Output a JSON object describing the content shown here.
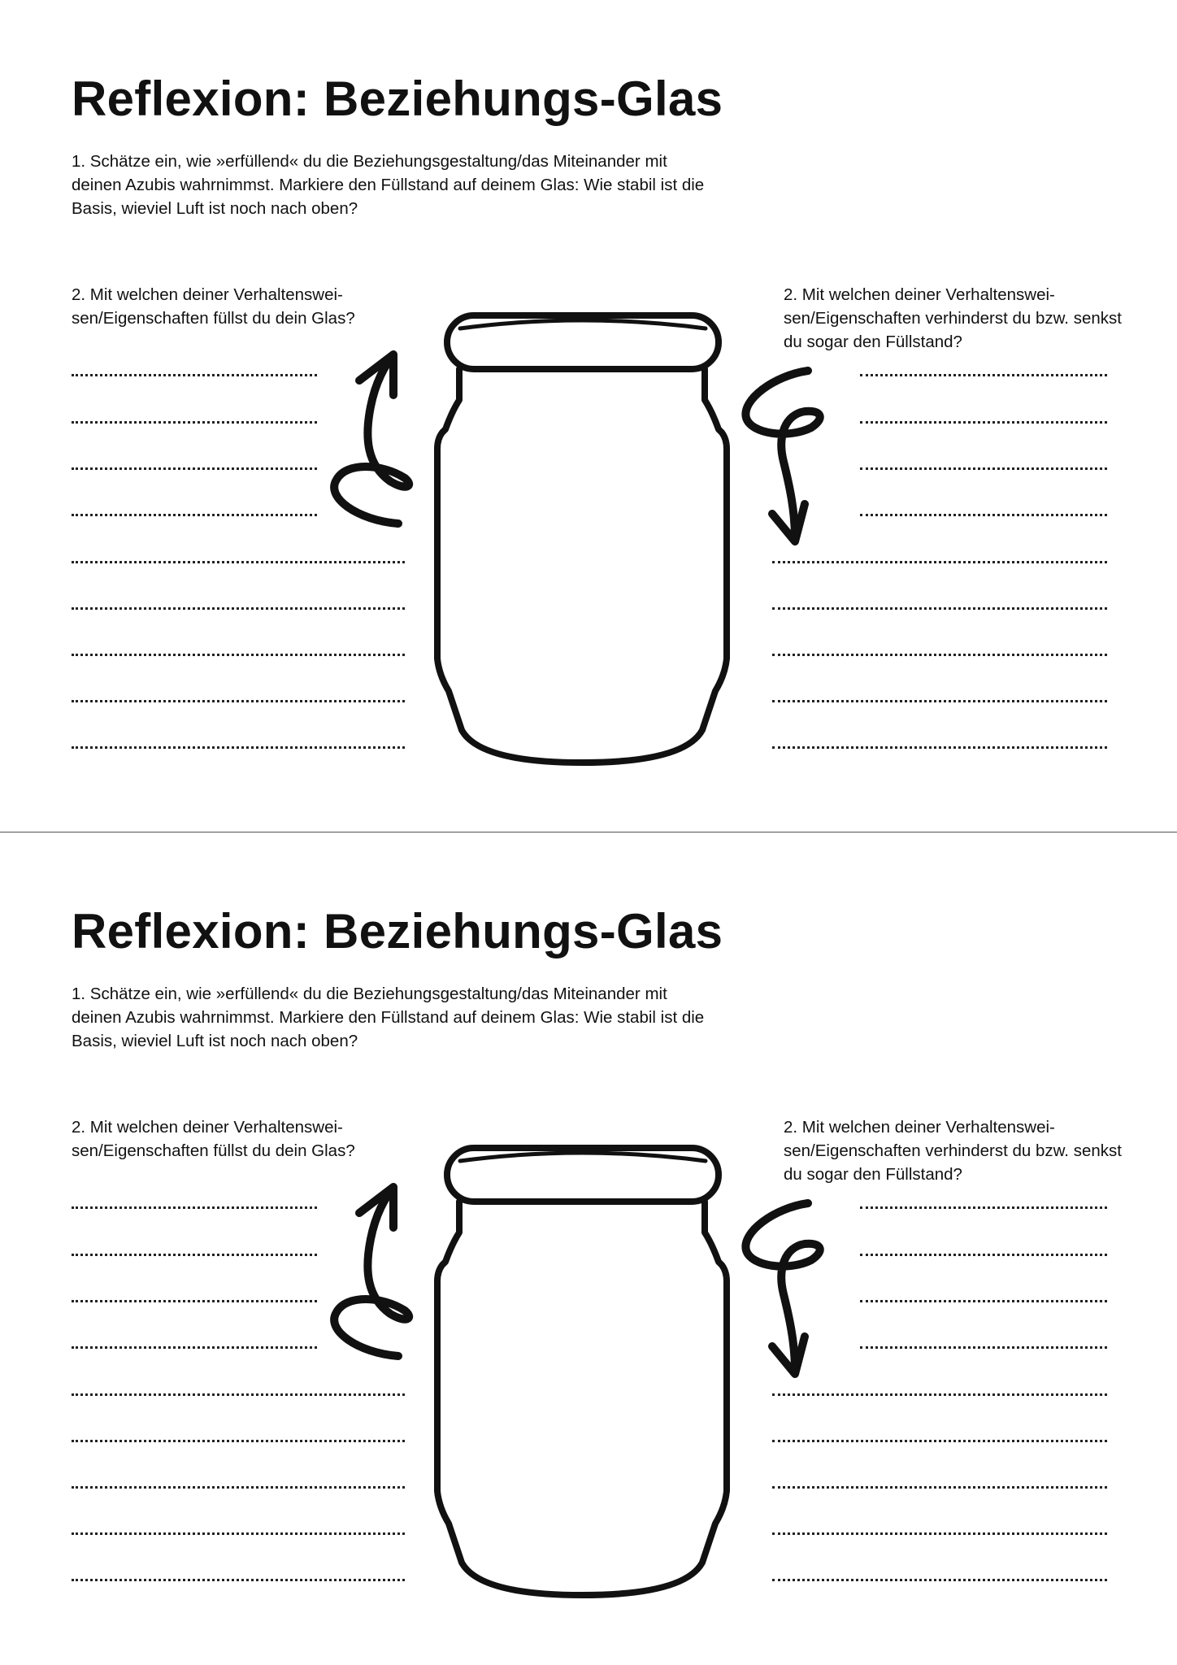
{
  "worksheets": [
    {
      "title": "Reflexion: Beziehungs-Glas",
      "intro": "1. Schätze ein, wie »erfüllend« du die Beziehungsgestaltung/das Miteinander mit deinen Azubis wahrnimmst. Markiere den Füllstand auf deinem Glas: Wie stabil ist die Basis, wieviel Luft ist noch nach oben?",
      "question_left": "2. Mit welchen deiner Verhaltenswei-sen/Eigenschaften füllst du dein Glas?",
      "question_right": "2. Mit welchen deiner Verhaltenswei-sen/Eigenschaften verhinderst du bzw. senkst du sogar den Füllstand?"
    },
    {
      "title": "Reflexion: Beziehungs-Glas",
      "intro": "1. Schätze ein, wie »erfüllend« du die Beziehungsgestaltung/das Miteinander mit deinen Azubis wahrnimmst. Markiere den Füllstand auf deinem Glas: Wie stabil ist die Basis, wieviel Luft ist noch nach oben?",
      "question_left": "2. Mit welchen deiner Verhaltenswei-sen/Eigenschaften füllst du dein Glas?",
      "question_right": "2. Mit welchen deiner Verhaltenswei-sen/Eigenschaften verhinderst du bzw. senkst du sogar den Füllstand?"
    }
  ],
  "icons": {
    "jar": "jar-icon",
    "arrow_up": "curly-arrow-up-icon",
    "arrow_down": "curly-arrow-down-icon"
  }
}
